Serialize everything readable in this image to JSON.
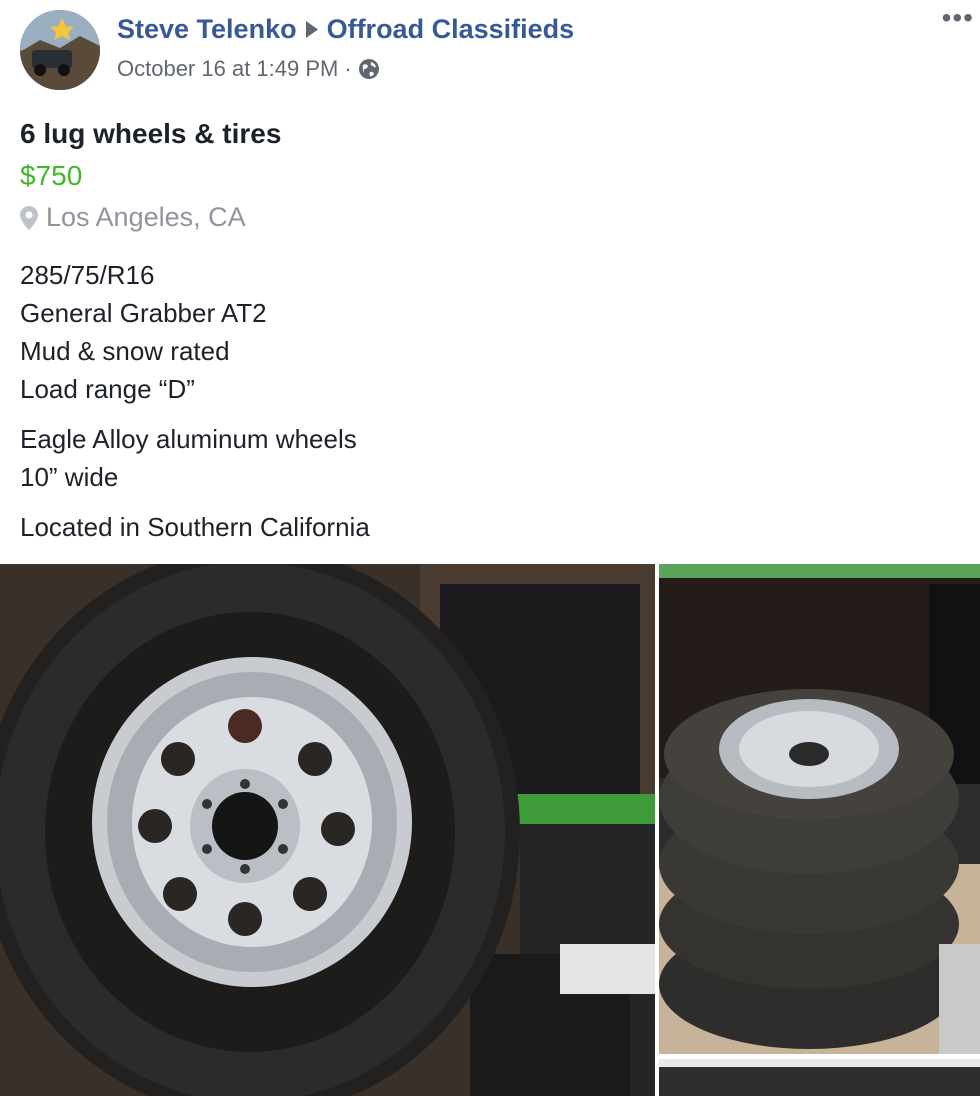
{
  "post": {
    "author": "Steve Telenko",
    "group": "Offroad Classifieds",
    "timestamp": "October 16 at 1:49 PM",
    "separator": "·",
    "privacy_icon": "globe-icon",
    "more_icon": "more-options-icon",
    "more_glyph": "•••"
  },
  "listing": {
    "title": "6 lug wheels & tires",
    "price": "$750",
    "location": "Los Angeles, CA",
    "location_icon": "map-pin-icon",
    "price_color": "#42b72a"
  },
  "description": {
    "block1": [
      "285/75/R16",
      "General Grabber AT2",
      "Mud & snow rated",
      "Load range “D”"
    ],
    "block2": [
      "Eagle Alloy aluminum wheels",
      "10” wide"
    ],
    "block3": [
      "Located in Southern California"
    ]
  },
  "colors": {
    "link": "#385898",
    "meta": "#616770",
    "text": "#1d2129"
  }
}
